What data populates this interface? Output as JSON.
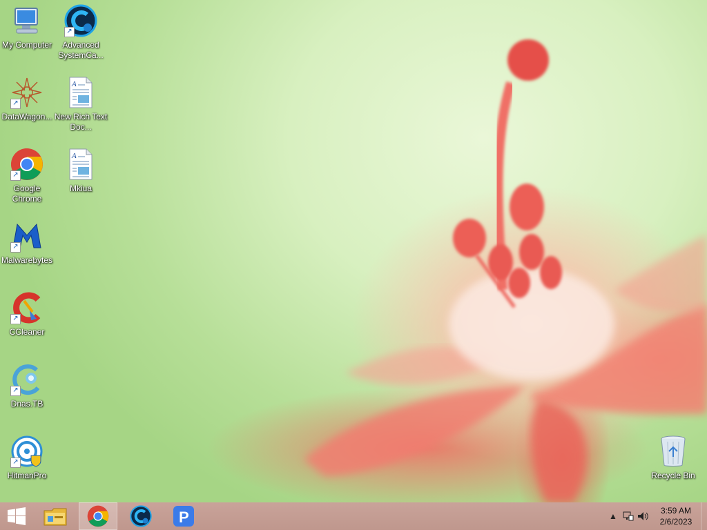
{
  "desktop": {
    "icons": [
      {
        "label": "My Computer",
        "icon": "computer-icon"
      },
      {
        "label": "Advanced SystemCa...",
        "icon": "advanced-systemcare-icon"
      },
      {
        "label": "DataWagon...",
        "icon": "datawagon-icon"
      },
      {
        "label": "New Rich Text Doc...",
        "icon": "rich-text-document-icon"
      },
      {
        "label": "Google Chrome",
        "icon": "chrome-icon"
      },
      {
        "label": "Mkiua",
        "icon": "rich-text-document-icon"
      },
      {
        "label": "Malwarebytes",
        "icon": "malwarebytes-icon"
      },
      {
        "label": "CCleaner",
        "icon": "ccleaner-icon"
      },
      {
        "label": "Dnas.TB",
        "icon": "dnas-tb-icon"
      },
      {
        "label": "HitmanPro",
        "icon": "hitmanpro-icon"
      },
      {
        "label": "Recycle Bin",
        "icon": "recycle-bin-icon"
      }
    ]
  },
  "taskbar": {
    "items": [
      "start-icon",
      "file-explorer-icon",
      "chrome-icon",
      "advanced-systemcare-icon",
      "p-app-icon"
    ],
    "active": "chrome-icon"
  },
  "tray": {
    "time": "3:59 AM",
    "date": "2/6/2023"
  },
  "colors": {
    "taskbar": "#c49d93",
    "desktop_green": "#c8e9b0",
    "flower_pink": "#f07a6c"
  }
}
